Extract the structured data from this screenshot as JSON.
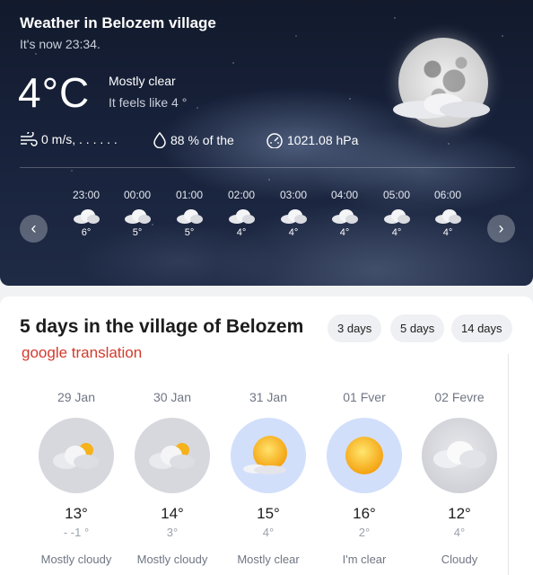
{
  "current": {
    "title": "Weather in Belozem village",
    "time_text": "It's now 23:34.",
    "temperature": "4°C",
    "condition": "Mostly clear",
    "feels_like": "It feels like 4 °",
    "wind": "0 m/s, . . . . . .",
    "humidity": "88 % of the",
    "pressure": "1021.08 hPa",
    "icon": "moon-cloud-icon"
  },
  "hourly": [
    {
      "time": "23:00",
      "temp": "6°",
      "icon": "cloud-icon"
    },
    {
      "time": "00:00",
      "temp": "5°",
      "icon": "cloud-icon"
    },
    {
      "time": "01:00",
      "temp": "5°",
      "icon": "cloud-icon"
    },
    {
      "time": "02:00",
      "temp": "4°",
      "icon": "cloud-icon"
    },
    {
      "time": "03:00",
      "temp": "4°",
      "icon": "cloud-icon"
    },
    {
      "time": "04:00",
      "temp": "4°",
      "icon": "cloud-icon"
    },
    {
      "time": "05:00",
      "temp": "4°",
      "icon": "cloud-icon"
    },
    {
      "time": "06:00",
      "temp": "4°",
      "icon": "cloud-icon"
    }
  ],
  "nav": {
    "prev": "‹",
    "next": "›"
  },
  "forecast": {
    "title": "5 days in the village of Belozem",
    "translation_note": "google translation",
    "ranges": [
      "3 days",
      "5 days",
      "14 days"
    ],
    "days": [
      {
        "date": "29 Jan",
        "high": "13°",
        "low": "- -1 °",
        "condition": "Mostly cloudy",
        "icon": "sun-behind-cloud-icon"
      },
      {
        "date": "30 Jan",
        "high": "14°",
        "low": "3°",
        "condition": "Mostly cloudy",
        "icon": "sun-behind-cloud-icon"
      },
      {
        "date": "31 Jan",
        "high": "15°",
        "low": "4°",
        "condition": "Mostly clear",
        "icon": "sun-small-cloud-icon"
      },
      {
        "date": "01 Fver",
        "high": "16°",
        "low": "2°",
        "condition": "I'm clear",
        "icon": "sun-icon"
      },
      {
        "date": "02 Fevre",
        "high": "12°",
        "low": "4°",
        "condition": "Cloudy",
        "icon": "cloud-icon"
      }
    ]
  },
  "colors": {
    "accent_red": "#d33a2c",
    "sunny_circle": "#d2dffb",
    "cloudy_circle": "#d7d8dd"
  }
}
